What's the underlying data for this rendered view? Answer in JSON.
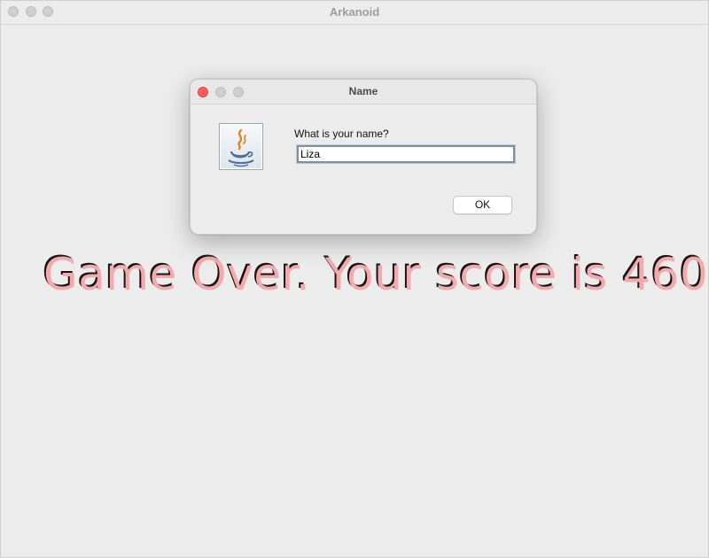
{
  "window": {
    "title": "Arkanoid"
  },
  "game": {
    "message": "Game Over. Your score is 460",
    "score": 460,
    "text_color": "#f4a9ad",
    "shadow_color": "#151515"
  },
  "dialog": {
    "title": "Name",
    "icon": "java-coffee-cup-icon",
    "prompt": "What is your name?",
    "input_value": "Liza",
    "ok_label": "OK",
    "close_color": "#fd5c57"
  }
}
